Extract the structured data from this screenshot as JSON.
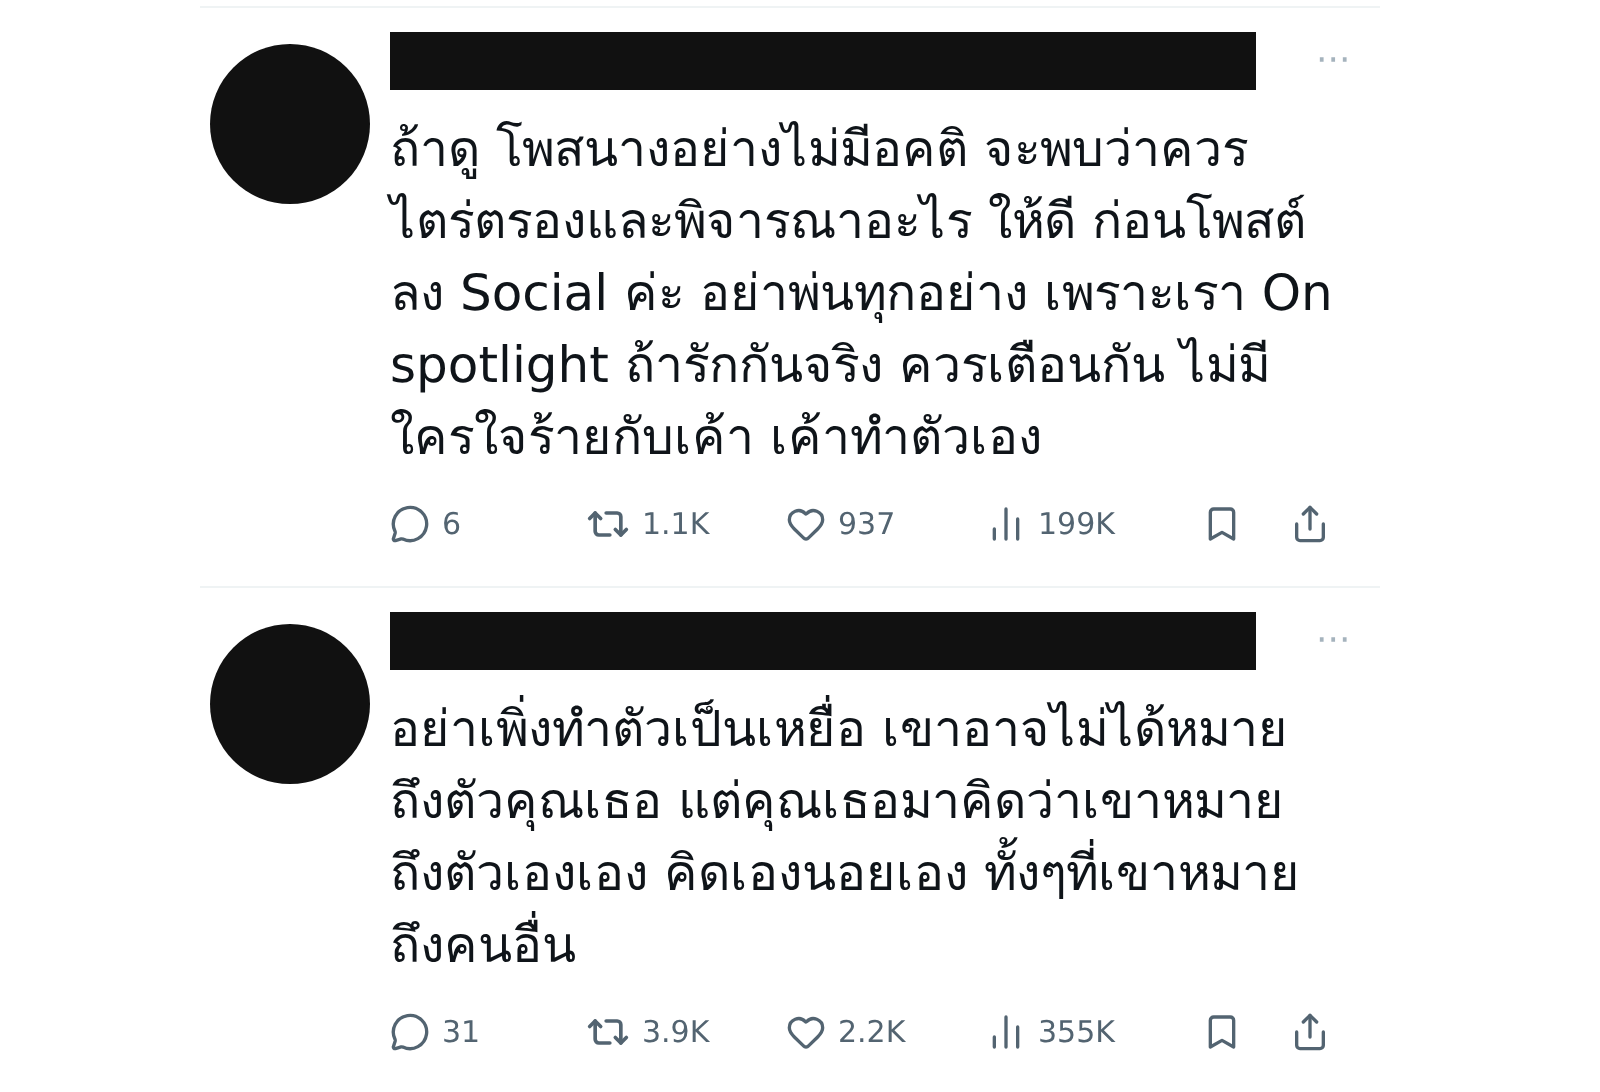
{
  "tweets": [
    {
      "more": "···",
      "lines": [
        "ถ้าดู โพสนางอย่างไม่มีอคติ จะพบว่าควร",
        "ไตร่ตรองและพิจารณาอะไร ให้ดี ก่อนโพสต์",
        "ลง Social ค่ะ อย่าพ่นทุกอย่าง เพราะเรา On",
        "spotlight ถ้ารักกันจริง ควรเตือนกัน ไม่มี",
        "ใครใจร้ายกับเค้า เค้าทำตัวเอง"
      ],
      "replies": "6",
      "reposts": "1.1K",
      "likes": "937",
      "views": "199K"
    },
    {
      "more": "···",
      "lines": [
        "อย่าเพิ่งทำตัวเป็นเหยื่อ เขาอาจไม่ได้หมาย",
        "ถึงตัวคุณเธอ แต่คุณเธอมาคิดว่าเขาหมาย",
        "ถึงตัวเองเอง คิดเองนอยเอง ทั้งๆที่เขาหมาย",
        "ถึงคนอื่น"
      ],
      "replies": "31",
      "reposts": "3.9K",
      "likes": "2.2K",
      "views": "355K"
    }
  ]
}
